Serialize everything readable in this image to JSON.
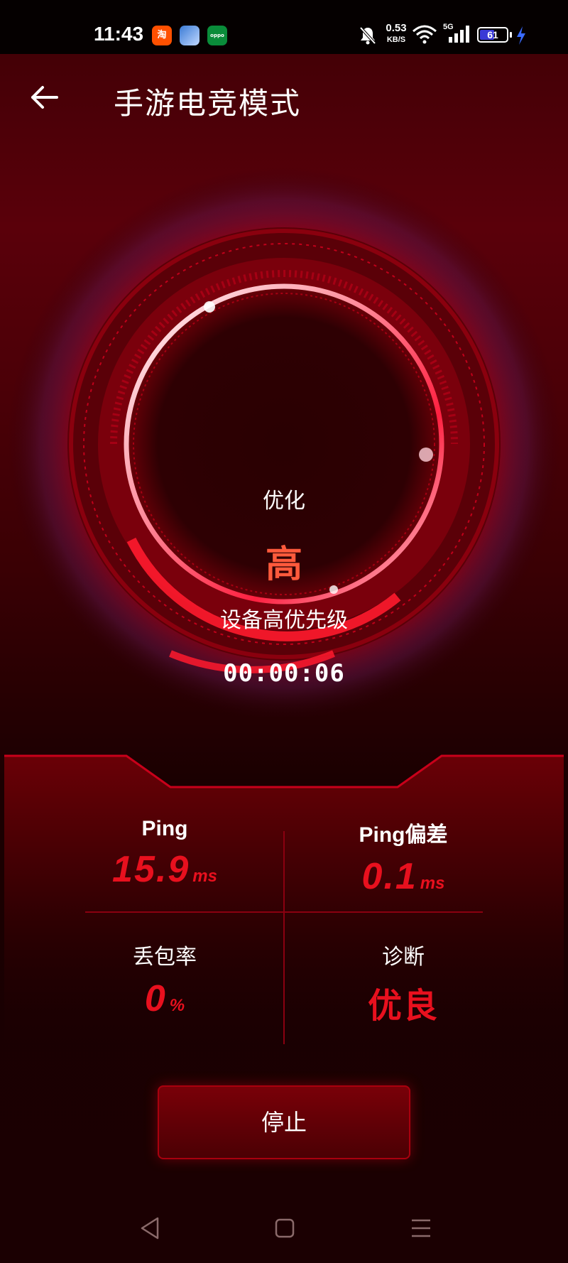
{
  "status_bar": {
    "time": "11:43",
    "net_speed_value": "0.53",
    "net_speed_unit": "KB/S",
    "signal_label": "5G",
    "battery_level": "61",
    "battery_percent": 61,
    "notification_icons": [
      "taobao-icon",
      "game-app-icon",
      "oppo-icon"
    ],
    "oppo_icon_text": "oppo",
    "taobao_icon_text": "淘"
  },
  "header": {
    "title": "手游电竞模式"
  },
  "gauge": {
    "label": "优化",
    "level": "高",
    "description": "设备高优先级",
    "timer": "00:00:06"
  },
  "stats": {
    "ping": {
      "label": "Ping",
      "value": "15.9",
      "unit": "ms"
    },
    "jitter": {
      "label": "Ping偏差",
      "value": "0.1",
      "unit": "ms"
    },
    "packet_loss": {
      "label": "丢包率",
      "value": "0",
      "unit": "%"
    },
    "diagnosis": {
      "label": "诊断",
      "value": "优良"
    }
  },
  "actions": {
    "stop_label": "停止"
  },
  "colors": {
    "accent_red": "#e8101e",
    "level_orange": "#ff5a3c",
    "background_dark": "#1b0002"
  }
}
